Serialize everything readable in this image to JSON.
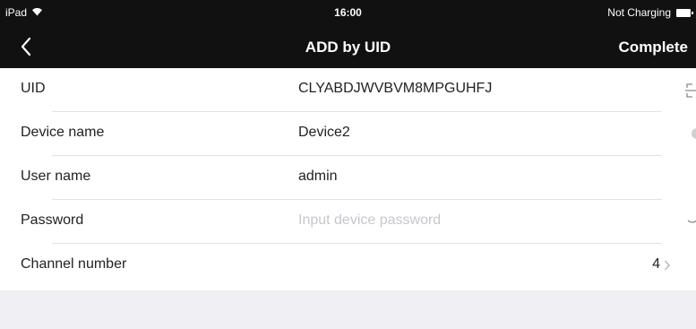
{
  "status_bar": {
    "device": "iPad",
    "time": "16:00",
    "charging": "Not Charging",
    "icons": [
      "wifi-icon",
      "battery-icon"
    ]
  },
  "nav": {
    "back_icon": "chevron-left-icon",
    "title": "ADD by UID",
    "complete_label": "Complete"
  },
  "form": {
    "uid": {
      "label": "UID",
      "value": "CLYABDJWVBVM8MPGUHFJ",
      "icon": "qr-scan-icon"
    },
    "device_name": {
      "label": "Device name",
      "value": "Device2",
      "icon": "clear-icon"
    },
    "user_name": {
      "label": "User name",
      "value": "admin"
    },
    "password": {
      "label": "Password",
      "value": "",
      "placeholder": "Input device password",
      "icon": "eye-icon"
    },
    "channel_number": {
      "label": "Channel number",
      "value": "4",
      "icon": "chevron-right-icon"
    }
  },
  "colors": {
    "bar_background": "#111111",
    "page_background": "#efeff4",
    "placeholder": "#c7c7cc"
  }
}
